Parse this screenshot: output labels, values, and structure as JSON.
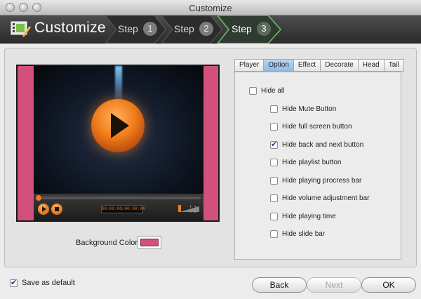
{
  "window": {
    "title": "Customize"
  },
  "header": {
    "title": "Customize",
    "steps": [
      {
        "label": "Step",
        "num": "1",
        "active": false
      },
      {
        "label": "Step",
        "num": "2",
        "active": false
      },
      {
        "label": "Step",
        "num": "3",
        "active": true
      }
    ]
  },
  "preview": {
    "time": "00:00:00/00:00:04",
    "bg_color_label": "Background Color:",
    "bg_color": "#d2507a"
  },
  "tabs": [
    {
      "label": "Player",
      "selected": false
    },
    {
      "label": "Option",
      "selected": true
    },
    {
      "label": "Effect",
      "selected": false
    },
    {
      "label": "Decorate",
      "selected": false
    },
    {
      "label": "Head",
      "selected": false
    },
    {
      "label": "Tail",
      "selected": false
    }
  ],
  "options": [
    {
      "label": "Hide all",
      "checked": false
    },
    {
      "label": "Hide Mute Button",
      "checked": false
    },
    {
      "label": "Hide full screen button",
      "checked": false
    },
    {
      "label": "Hide back and next button",
      "checked": true
    },
    {
      "label": "Hide playlist button",
      "checked": false
    },
    {
      "label": "Hide playing procress bar",
      "checked": false
    },
    {
      "label": "Hide volume adjustment bar",
      "checked": false
    },
    {
      "label": "Hide playing time",
      "checked": false
    },
    {
      "label": "Hide slide bar",
      "checked": false
    }
  ],
  "footer": {
    "save_default_label": "Save as default",
    "save_default_checked": true,
    "back": "Back",
    "next": "Next",
    "ok": "OK"
  },
  "icons": {
    "close": "close-icon",
    "minimize": "minimize-icon",
    "zoom": "zoom-icon",
    "logo": "film-icon",
    "play": "play-icon",
    "stop": "stop-icon",
    "fullscreen": "fullscreen-icon",
    "volume": "volume-icon",
    "checkmark": "checkmark-icon"
  },
  "colors": {
    "accent": "#f07a1a",
    "tab_selected": "#8fb7e3",
    "header_bg": "#3a3a3a"
  }
}
